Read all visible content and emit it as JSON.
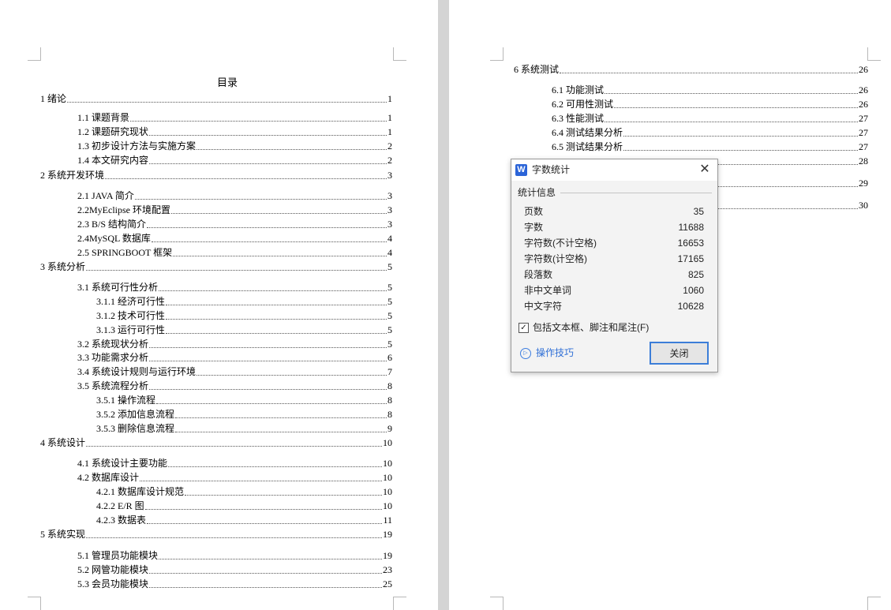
{
  "left_page": {
    "title": "目录",
    "entries": [
      {
        "text": "1  绪论",
        "page": "1"
      },
      {
        "text": "1.1  课题背景",
        "page": "1"
      },
      {
        "text": "1.2  课题研究现状",
        "page": "1"
      },
      {
        "text": "1.3  初步设计方法与实施方案",
        "page": "2"
      },
      {
        "text": "1.4  本文研究内容",
        "page": "2"
      },
      {
        "text": "2  系统开发环境",
        "page": "3"
      },
      {
        "text": "2.1 JAVA 简介",
        "page": "3"
      },
      {
        "text": "2.2MyEclipse 环境配置",
        "page": "3"
      },
      {
        "text": "2.3 B/S 结构简介",
        "page": "3"
      },
      {
        "text": "2.4MySQL 数据库",
        "page": "4"
      },
      {
        "text": "2.5 SPRINGBOOT 框架",
        "page": "4"
      },
      {
        "text": "3  系统分析",
        "page": "5"
      },
      {
        "text": "3.1  系统可行性分析",
        "page": "5"
      },
      {
        "text": "3.1.1  经济可行性",
        "page": "5"
      },
      {
        "text": "3.1.2  技术可行性",
        "page": "5"
      },
      {
        "text": "3.1.3  运行可行性",
        "page": "5"
      },
      {
        "text": "3.2  系统现状分析",
        "page": "5"
      },
      {
        "text": "3.3  功能需求分析",
        "page": "6"
      },
      {
        "text": "3.4  系统设计规则与运行环境",
        "page": "7"
      },
      {
        "text": "3.5 系统流程分析",
        "page": "8"
      },
      {
        "text": "3.5.1 操作流程",
        "page": "8"
      },
      {
        "text": "3.5.2 添加信息流程",
        "page": "8"
      },
      {
        "text": "3.5.3 删除信息流程",
        "page": "9"
      },
      {
        "text": "4  系统设计",
        "page": "10"
      },
      {
        "text": "4.1  系统设计主要功能",
        "page": "10"
      },
      {
        "text": "4.2  数据库设计",
        "page": "10"
      },
      {
        "text": "4.2.1  数据库设计规范",
        "page": "10"
      },
      {
        "text": "4.2.2 E/R 图",
        "page": "10"
      },
      {
        "text": "4.2.3  数据表",
        "page": "11"
      },
      {
        "text": "5  系统实现",
        "page": "19"
      },
      {
        "text": "5.1  管理员功能模块",
        "page": "19"
      },
      {
        "text": "5.2  网管功能模块",
        "page": "23"
      },
      {
        "text": "5.3  会员功能模块",
        "page": "25"
      }
    ]
  },
  "right_page": {
    "entries": [
      {
        "text": "6  系统测试",
        "page": "26"
      },
      {
        "text": "6.1  功能测试",
        "page": "26"
      },
      {
        "text": "6.2  可用性测试",
        "page": "26"
      },
      {
        "text": "6.3  性能测试",
        "page": "27"
      },
      {
        "text": "6.4  测试结果分析",
        "page": "27"
      },
      {
        "text": "6.5  测试结果分析",
        "page": "27"
      },
      {
        "text": "",
        "page": "28"
      },
      {
        "text": "",
        "page": "29"
      },
      {
        "text": "",
        "page": "30"
      }
    ]
  },
  "dialog": {
    "logo": "W",
    "title": "字数统计",
    "close_glyph": "✕",
    "group_label": "统计信息",
    "stats": [
      {
        "label": "页数",
        "value": "35"
      },
      {
        "label": "字数",
        "value": "11688"
      },
      {
        "label": "字符数(不计空格)",
        "value": "16653"
      },
      {
        "label": "字符数(计空格)",
        "value": "17165"
      },
      {
        "label": "段落数",
        "value": "825"
      },
      {
        "label": "非中文单词",
        "value": "1060"
      },
      {
        "label": "中文字符",
        "value": "10628"
      }
    ],
    "checkbox_checked": true,
    "checkbox_glyph": "✓",
    "checkbox_label": "包括文本框、脚注和尾注(F)",
    "tips_glyph": "▷",
    "tips_label": "操作技巧",
    "close_button_label": "关闭",
    "accent_color": "#3c7ed8"
  }
}
